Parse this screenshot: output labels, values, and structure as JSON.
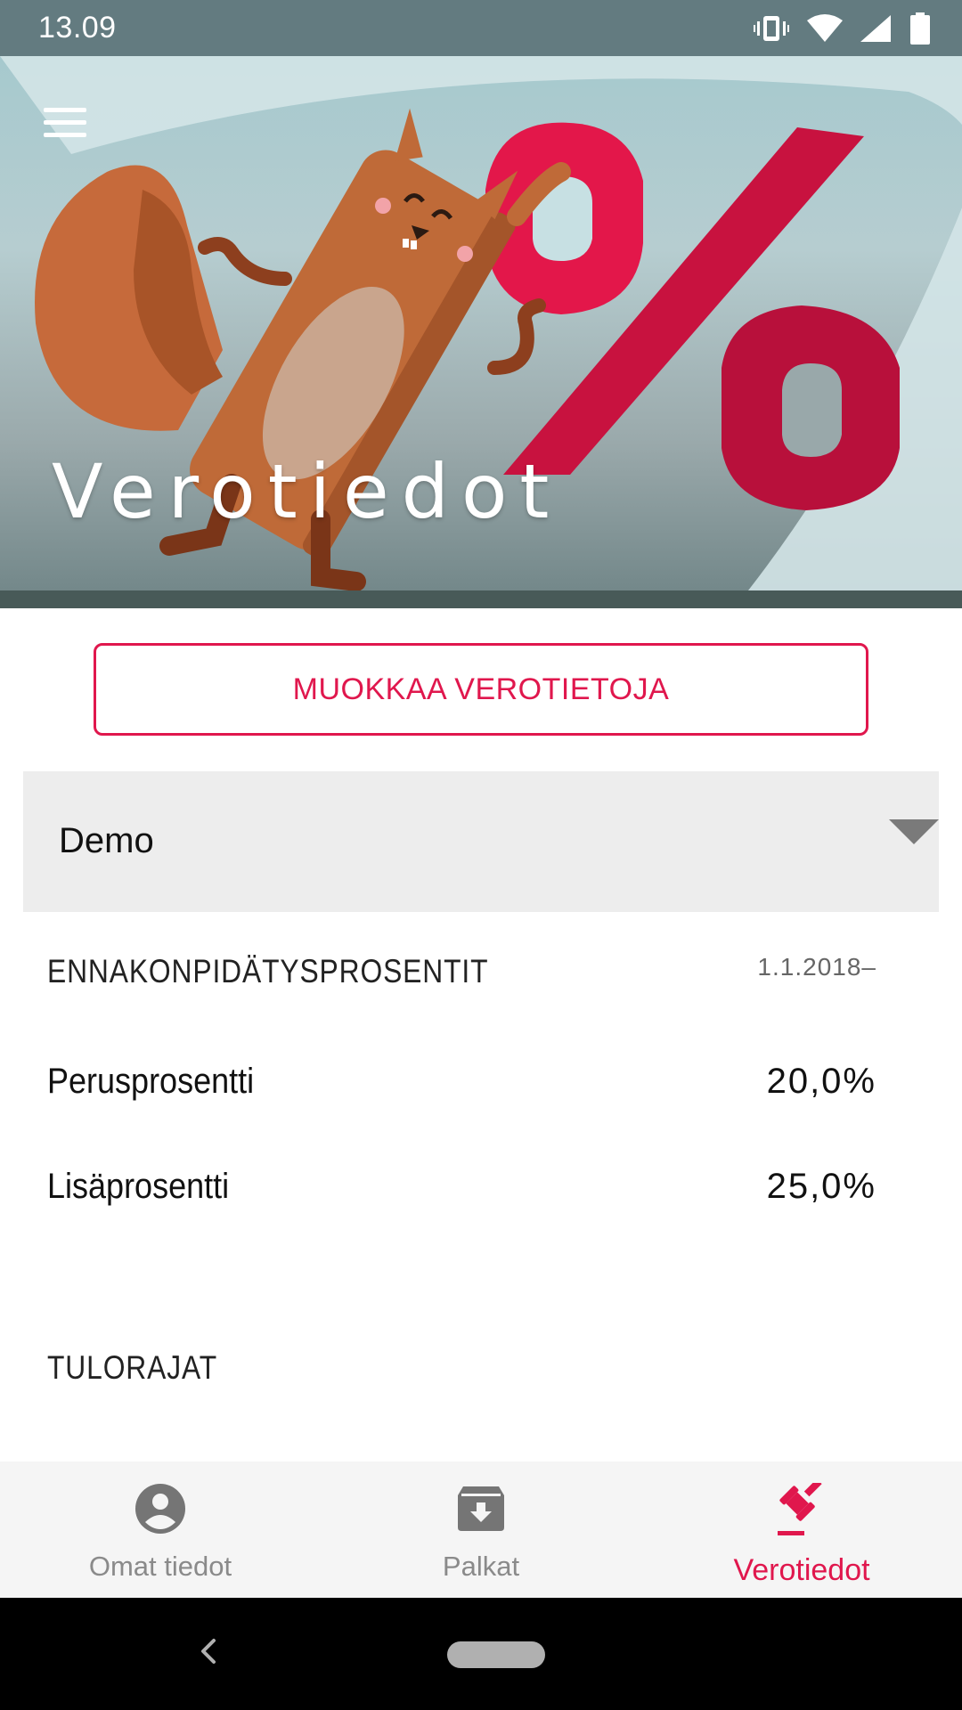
{
  "status_bar": {
    "time": "13.09",
    "icons": [
      "vibrate-icon",
      "wifi-icon",
      "signal-icon",
      "battery-icon"
    ]
  },
  "hero": {
    "title": "Verotiedot",
    "menu_icon": "hamburger-menu-icon",
    "illustration": "squirrel-percent-illustration"
  },
  "edit_button": {
    "label": "MUOKKAA VEROTIETOJA"
  },
  "employer_select": {
    "selected": "Demo",
    "icon": "dropdown-arrow-icon"
  },
  "withholding": {
    "heading": "ENNAKONPIDÄTYSPROSENTIT",
    "date": "1.1.2018–",
    "rows": [
      {
        "label": "Perusprosentti",
        "value": "20,0%"
      },
      {
        "label": "Lisäprosentti",
        "value": "25,0%"
      }
    ]
  },
  "income_limits": {
    "heading": "TULORAJAT"
  },
  "bottom_nav": {
    "items": [
      {
        "label": "Omat tiedot",
        "icon": "account-circle-icon",
        "active": false
      },
      {
        "label": "Palkat",
        "icon": "archive-download-icon",
        "active": false
      },
      {
        "label": "Verotiedot",
        "icon": "gavel-icon",
        "active": true
      }
    ]
  },
  "system_nav": {
    "back_icon": "back-chevron-icon",
    "home_icon": "home-pill-icon"
  },
  "colors": {
    "accent": "#e0174d",
    "status_bar": "#637b80",
    "select_background": "#ededed",
    "nav_inactive": "#8a8a8a"
  }
}
